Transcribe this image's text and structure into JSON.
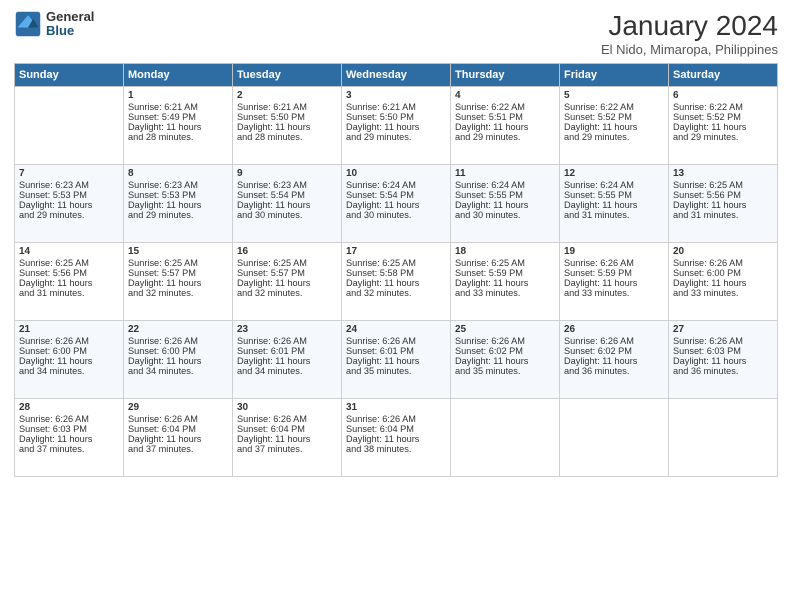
{
  "logo": {
    "general": "General",
    "blue": "Blue"
  },
  "title": "January 2024",
  "subtitle": "El Nido, Mimaropa, Philippines",
  "days_header": [
    "Sunday",
    "Monday",
    "Tuesday",
    "Wednesday",
    "Thursday",
    "Friday",
    "Saturday"
  ],
  "weeks": [
    [
      {
        "day": "",
        "info": ""
      },
      {
        "day": "1",
        "info": "Sunrise: 6:21 AM\nSunset: 5:49 PM\nDaylight: 11 hours\nand 28 minutes."
      },
      {
        "day": "2",
        "info": "Sunrise: 6:21 AM\nSunset: 5:50 PM\nDaylight: 11 hours\nand 28 minutes."
      },
      {
        "day": "3",
        "info": "Sunrise: 6:21 AM\nSunset: 5:50 PM\nDaylight: 11 hours\nand 29 minutes."
      },
      {
        "day": "4",
        "info": "Sunrise: 6:22 AM\nSunset: 5:51 PM\nDaylight: 11 hours\nand 29 minutes."
      },
      {
        "day": "5",
        "info": "Sunrise: 6:22 AM\nSunset: 5:52 PM\nDaylight: 11 hours\nand 29 minutes."
      },
      {
        "day": "6",
        "info": "Sunrise: 6:22 AM\nSunset: 5:52 PM\nDaylight: 11 hours\nand 29 minutes."
      }
    ],
    [
      {
        "day": "7",
        "info": "Sunrise: 6:23 AM\nSunset: 5:53 PM\nDaylight: 11 hours\nand 29 minutes."
      },
      {
        "day": "8",
        "info": "Sunrise: 6:23 AM\nSunset: 5:53 PM\nDaylight: 11 hours\nand 29 minutes."
      },
      {
        "day": "9",
        "info": "Sunrise: 6:23 AM\nSunset: 5:54 PM\nDaylight: 11 hours\nand 30 minutes."
      },
      {
        "day": "10",
        "info": "Sunrise: 6:24 AM\nSunset: 5:54 PM\nDaylight: 11 hours\nand 30 minutes."
      },
      {
        "day": "11",
        "info": "Sunrise: 6:24 AM\nSunset: 5:55 PM\nDaylight: 11 hours\nand 30 minutes."
      },
      {
        "day": "12",
        "info": "Sunrise: 6:24 AM\nSunset: 5:55 PM\nDaylight: 11 hours\nand 31 minutes."
      },
      {
        "day": "13",
        "info": "Sunrise: 6:25 AM\nSunset: 5:56 PM\nDaylight: 11 hours\nand 31 minutes."
      }
    ],
    [
      {
        "day": "14",
        "info": "Sunrise: 6:25 AM\nSunset: 5:56 PM\nDaylight: 11 hours\nand 31 minutes."
      },
      {
        "day": "15",
        "info": "Sunrise: 6:25 AM\nSunset: 5:57 PM\nDaylight: 11 hours\nand 32 minutes."
      },
      {
        "day": "16",
        "info": "Sunrise: 6:25 AM\nSunset: 5:57 PM\nDaylight: 11 hours\nand 32 minutes."
      },
      {
        "day": "17",
        "info": "Sunrise: 6:25 AM\nSunset: 5:58 PM\nDaylight: 11 hours\nand 32 minutes."
      },
      {
        "day": "18",
        "info": "Sunrise: 6:25 AM\nSunset: 5:59 PM\nDaylight: 11 hours\nand 33 minutes."
      },
      {
        "day": "19",
        "info": "Sunrise: 6:26 AM\nSunset: 5:59 PM\nDaylight: 11 hours\nand 33 minutes."
      },
      {
        "day": "20",
        "info": "Sunrise: 6:26 AM\nSunset: 6:00 PM\nDaylight: 11 hours\nand 33 minutes."
      }
    ],
    [
      {
        "day": "21",
        "info": "Sunrise: 6:26 AM\nSunset: 6:00 PM\nDaylight: 11 hours\nand 34 minutes."
      },
      {
        "day": "22",
        "info": "Sunrise: 6:26 AM\nSunset: 6:00 PM\nDaylight: 11 hours\nand 34 minutes."
      },
      {
        "day": "23",
        "info": "Sunrise: 6:26 AM\nSunset: 6:01 PM\nDaylight: 11 hours\nand 34 minutes."
      },
      {
        "day": "24",
        "info": "Sunrise: 6:26 AM\nSunset: 6:01 PM\nDaylight: 11 hours\nand 35 minutes."
      },
      {
        "day": "25",
        "info": "Sunrise: 6:26 AM\nSunset: 6:02 PM\nDaylight: 11 hours\nand 35 minutes."
      },
      {
        "day": "26",
        "info": "Sunrise: 6:26 AM\nSunset: 6:02 PM\nDaylight: 11 hours\nand 36 minutes."
      },
      {
        "day": "27",
        "info": "Sunrise: 6:26 AM\nSunset: 6:03 PM\nDaylight: 11 hours\nand 36 minutes."
      }
    ],
    [
      {
        "day": "28",
        "info": "Sunrise: 6:26 AM\nSunset: 6:03 PM\nDaylight: 11 hours\nand 37 minutes."
      },
      {
        "day": "29",
        "info": "Sunrise: 6:26 AM\nSunset: 6:04 PM\nDaylight: 11 hours\nand 37 minutes."
      },
      {
        "day": "30",
        "info": "Sunrise: 6:26 AM\nSunset: 6:04 PM\nDaylight: 11 hours\nand 37 minutes."
      },
      {
        "day": "31",
        "info": "Sunrise: 6:26 AM\nSunset: 6:04 PM\nDaylight: 11 hours\nand 38 minutes."
      },
      {
        "day": "",
        "info": ""
      },
      {
        "day": "",
        "info": ""
      },
      {
        "day": "",
        "info": ""
      }
    ]
  ]
}
